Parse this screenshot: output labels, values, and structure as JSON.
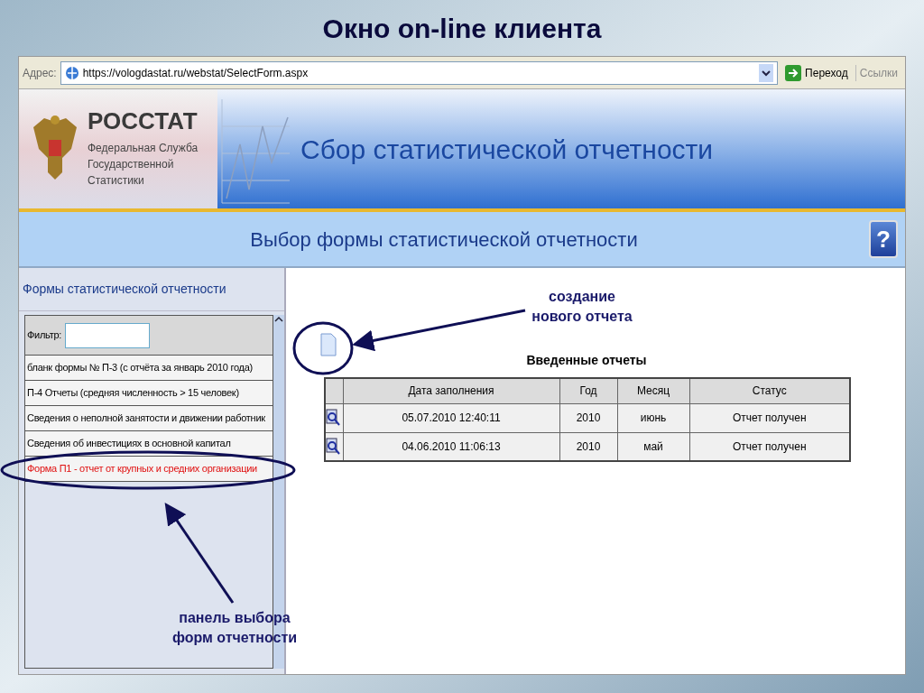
{
  "slide_title": "Окно on-line клиента",
  "address_bar": {
    "label": "Адрес:",
    "url": "https://vologdastat.ru/webstat/SelectForm.aspx",
    "go_button": "Переход",
    "links": "Ссылки"
  },
  "header": {
    "org_name": "РОССТАТ",
    "org_subtitle": [
      "Федеральная Служба",
      "Государственной",
      "Статистики"
    ],
    "title": "Сбор статистической отчетности"
  },
  "page_title": "Выбор формы статистической отчетности",
  "help_button": "?",
  "sidebar": {
    "title": "Формы статистической отчетности",
    "filter_label": "Фильтр:",
    "items": [
      {
        "label": "бланк формы № П-3 (с отчёта за январь 2010 года)",
        "selected": false
      },
      {
        "label": "П-4 Отчеты (средняя численность > 15 человек)",
        "selected": false
      },
      {
        "label": "Сведения о неполной занятости и движении работник",
        "selected": false
      },
      {
        "label": "Сведения об инвестициях в основной капитал",
        "selected": false
      },
      {
        "label": "Форма П1 - отчет от крупных и средних организации",
        "selected": true
      }
    ]
  },
  "reports": {
    "title": "Введенные отчеты",
    "columns": [
      "Дата заполнения",
      "Год",
      "Месяц",
      "Статус"
    ],
    "rows": [
      {
        "date": "05.07.2010 12:40:11",
        "year": "2010",
        "month": "июнь",
        "status": "Отчет получен"
      },
      {
        "date": "04.06.2010 11:06:13",
        "year": "2010",
        "month": "май",
        "status": "Отчет получен"
      }
    ]
  },
  "callouts": {
    "new_report": [
      "создание",
      "нового отчета"
    ],
    "form_panel": [
      "панель выбора",
      "форм отчетности"
    ]
  }
}
